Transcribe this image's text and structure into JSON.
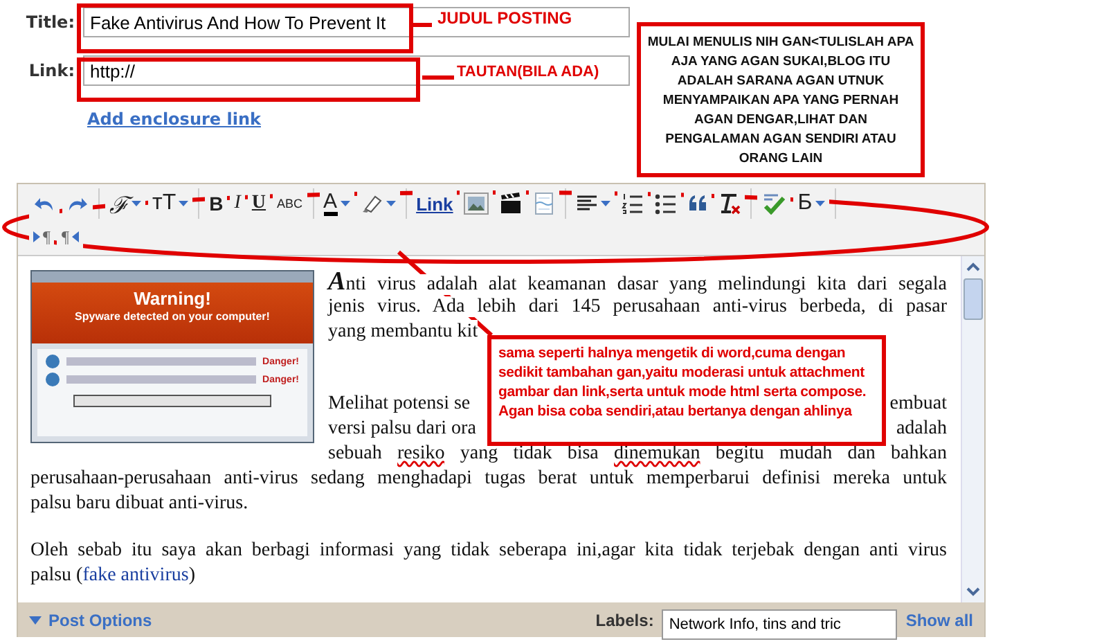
{
  "form": {
    "title_label": "Title:",
    "title_value": "Fake Antivirus And How To Prevent It",
    "link_label": "Link:",
    "link_value": "http://",
    "enclosure_link": "Add enclosure link"
  },
  "toolbar": {
    "rows": [
      {
        "groups": [
          [
            {
              "kind": "undo"
            },
            {
              "kind": "redo"
            }
          ],
          [
            {
              "kind": "font",
              "label": "ℱ",
              "dropdown": true
            },
            {
              "kind": "size",
              "label": "тT",
              "dropdown": true
            }
          ],
          [
            {
              "kind": "bold",
              "label": "B"
            },
            {
              "kind": "italic",
              "label": "I"
            },
            {
              "kind": "underline",
              "label": "U"
            },
            {
              "kind": "strike",
              "label": "ABC"
            }
          ],
          [
            {
              "kind": "color",
              "label": "A",
              "dropdown": true
            },
            {
              "kind": "highlight",
              "dropdown": true
            }
          ],
          [
            {
              "kind": "link",
              "label": "Link"
            },
            {
              "kind": "image"
            },
            {
              "kind": "video"
            },
            {
              "kind": "pagebreak"
            }
          ],
          [
            {
              "kind": "align",
              "dropdown": true
            },
            {
              "kind": "numbered"
            },
            {
              "kind": "bullets"
            },
            {
              "kind": "quote"
            },
            {
              "kind": "clear"
            }
          ],
          [
            {
              "kind": "spell"
            },
            {
              "kind": "translit",
              "label": "Б",
              "dropdown": true
            }
          ]
        ]
      },
      {
        "groups": [
          [
            {
              "kind": "ltr",
              "label": "¶"
            },
            {
              "kind": "rtl",
              "label": "¶"
            }
          ]
        ]
      }
    ]
  },
  "editor": {
    "image": {
      "title": "Warning!",
      "subtitle": "Spyware detected on your computer!",
      "rows": [
        {
          "status": "Danger!"
        },
        {
          "status": "Danger!"
        }
      ]
    },
    "side_lines": [
      {
        "kind": "justified",
        "segments": [
          {
            "text": "A",
            "initial": true
          },
          {
            "text": "nti virus adalah alat keamanan dasar yang melindungi kita dari segala"
          }
        ]
      },
      {
        "kind": "justified",
        "segments": [
          {
            "text": "jenis virus. Ada lebih dari 145 perusahaan anti-virus berbeda, di pasar"
          }
        ]
      },
      {
        "kind": "split",
        "parts": [
          "yang membantu kit"
        ]
      },
      {
        "kind": "gap"
      },
      {
        "kind": "split",
        "parts": [
          "Melihat potensi se",
          "embuat"
        ]
      },
      {
        "kind": "split",
        "parts": [
          "versi palsu dari ora",
          "adalah"
        ]
      },
      {
        "kind": "justified",
        "segments": [
          {
            "text": "sebuah "
          },
          {
            "text": "resiko",
            "misspelled": true
          },
          {
            "text": " yang tidak bisa "
          },
          {
            "text": "dinemukan",
            "misspelled": true
          },
          {
            "text": " begitu mudah dan bahkan"
          }
        ]
      }
    ],
    "full_lines": [
      {
        "kind": "justified",
        "segments": [
          {
            "text": "perusahaan-perusahaan anti-virus sedang menghadapi tugas berat untuk memperbarui definisi mereka untuk"
          }
        ]
      },
      {
        "kind": "plain",
        "segments": [
          {
            "text": "palsu baru dibuat anti-virus."
          }
        ]
      },
      {
        "kind": "gap"
      },
      {
        "kind": "justified",
        "segments": [
          {
            "text": "Oleh sebab itu saya akan berbagi informasi yang tidak seberapa ini,agar kita tidak terjebak dengan anti virus"
          }
        ]
      },
      {
        "kind": "plain",
        "segments": [
          {
            "text": "palsu ("
          },
          {
            "text": "fake antivirus",
            "link": true
          },
          {
            "text": ")"
          }
        ]
      }
    ]
  },
  "bottom": {
    "post_options": "Post Options",
    "labels_label": "Labels:",
    "labels_value": "Network Info, tins and tric",
    "show_all": "Show all"
  },
  "annotations": {
    "title_note": "JUDUL POSTING",
    "link_note": "TAUTAN(BILA ADA)",
    "top_note": "MULAI MENULIS NIH GAN<TULISLAH APA AJA YANG AGAN SUKAI,BLOG ITU ADALAH SARANA AGAN UTNUK MENYAMPAIKAN APA YANG PERNAH AGAN DENGAR,LIHAT DAN PENGALAMAN AGAN SENDIRI ATAU ORANG LAIN",
    "editor_note": "sama seperti halnya mengetik di word,cuma dengan sedikit tambahan gan,yaitu moderasi untuk attachment gambar dan link,serta untuk mode html serta compose. Agan bisa coba sendiri,atau bertanya dengan ahlinya"
  }
}
